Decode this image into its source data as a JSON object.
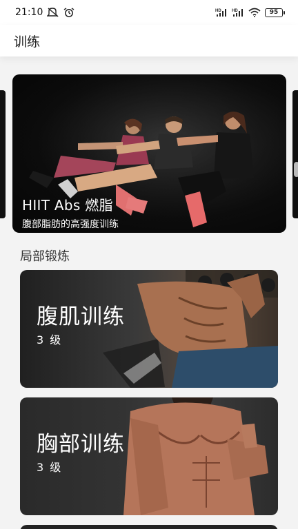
{
  "status_bar": {
    "time": "21:10",
    "battery": "95",
    "icons": [
      "mute-icon",
      "alarm-icon",
      "signal-hd-icon",
      "signal-hd-icon",
      "wifi-icon",
      "battery-icon"
    ]
  },
  "header": {
    "title": "训练"
  },
  "carousel": {
    "featured": {
      "title": "HIIT Abs 燃脂",
      "subtitle": "腹部脂肪的高强度训练"
    }
  },
  "section": {
    "title": "局部锻炼"
  },
  "workouts": [
    {
      "title": "腹肌训练",
      "level": "3 级"
    },
    {
      "title": "胸部训练",
      "level": "3 级"
    }
  ],
  "colors": {
    "background": "#f3f3f3",
    "header_bg": "#ffffff",
    "card_text": "#ffffff"
  }
}
